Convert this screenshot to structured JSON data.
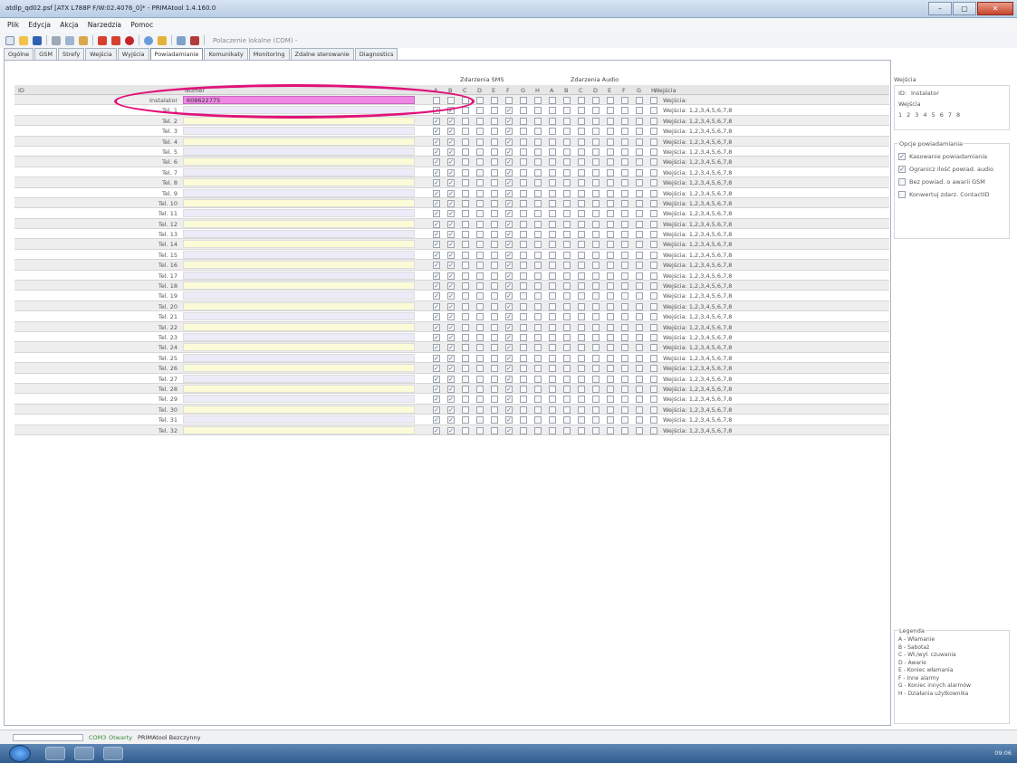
{
  "window": {
    "title": "atdlp_qd02.psf [ATX L788P F/W:02.4076_0]* - PRIMAtool 1.4.160.0",
    "buttons": [
      "–",
      "▢",
      "✕"
    ]
  },
  "menu": [
    "Plik",
    "Edycja",
    "Akcja",
    "Narzedzia",
    "Pomoc"
  ],
  "toolbar": {
    "connection_label": "Polaczenie lokalne (COM) -"
  },
  "tabs": [
    "Ogólne",
    "GSM",
    "Strefy",
    "Wejścia",
    "Wyjścia",
    "Powiadamianie",
    "Komunikaty",
    "Monitoring",
    "Zdalne sterowanie",
    "Diagnostics"
  ],
  "active_tab": "Powiadamianie",
  "group_headers": {
    "sms": "Zdarzenia SMS",
    "audio": "Zdarzenia Audio"
  },
  "columns": {
    "id": "ID",
    "name": "Numer",
    "sms_letters": [
      "A",
      "B",
      "C",
      "D",
      "E",
      "F",
      "G",
      "H"
    ],
    "audio_letters": [
      "A",
      "B",
      "C",
      "D",
      "E",
      "F",
      "G",
      "H"
    ],
    "inputs": "Wejścia"
  },
  "rows": [
    {
      "id": "Instalator",
      "number": "608622775",
      "inputs": "Wejścia:"
    },
    {
      "id": "Tel. 1",
      "number": "",
      "inputs": "Wejścia: 1,2,3,4,5,6,7,8"
    },
    {
      "id": "Tel. 2",
      "number": "",
      "inputs": "Wejścia: 1,2,3,4,5,6,7,8"
    },
    {
      "id": "Tel. 3",
      "number": "",
      "inputs": "Wejścia: 1,2,3,4,5,6,7,8"
    },
    {
      "id": "Tel. 4",
      "number": "",
      "inputs": "Wejścia: 1,2,3,4,5,6,7,8"
    },
    {
      "id": "Tel. 5",
      "number": "",
      "inputs": "Wejścia: 1,2,3,4,5,6,7,8"
    },
    {
      "id": "Tel. 6",
      "number": "",
      "inputs": "Wejścia: 1,2,3,4,5,6,7,8"
    },
    {
      "id": "Tel. 7",
      "number": "",
      "inputs": "Wejścia: 1,2,3,4,5,6,7,8"
    },
    {
      "id": "Tel. 8",
      "number": "",
      "inputs": "Wejścia: 1,2,3,4,5,6,7,8"
    },
    {
      "id": "Tel. 9",
      "number": "",
      "inputs": "Wejścia: 1,2,3,4,5,6,7,8"
    },
    {
      "id": "Tel. 10",
      "number": "",
      "inputs": "Wejścia: 1,2,3,4,5,6,7,8"
    },
    {
      "id": "Tel. 11",
      "number": "",
      "inputs": "Wejścia: 1,2,3,4,5,6,7,8"
    },
    {
      "id": "Tel. 12",
      "number": "",
      "inputs": "Wejścia: 1,2,3,4,5,6,7,8"
    },
    {
      "id": "Tel. 13",
      "number": "",
      "inputs": "Wejścia: 1,2,3,4,5,6,7,8"
    },
    {
      "id": "Tel. 14",
      "number": "",
      "inputs": "Wejścia: 1,2,3,4,5,6,7,8"
    },
    {
      "id": "Tel. 15",
      "number": "",
      "inputs": "Wejścia: 1,2,3,4,5,6,7,8"
    },
    {
      "id": "Tel. 16",
      "number": "",
      "inputs": "Wejścia: 1,2,3,4,5,6,7,8"
    },
    {
      "id": "Tel. 17",
      "number": "",
      "inputs": "Wejścia: 1,2,3,4,5,6,7,8"
    },
    {
      "id": "Tel. 18",
      "number": "",
      "inputs": "Wejścia: 1,2,3,4,5,6,7,8"
    },
    {
      "id": "Tel. 19",
      "number": "",
      "inputs": "Wejścia: 1,2,3,4,5,6,7,8"
    },
    {
      "id": "Tel. 20",
      "number": "",
      "inputs": "Wejścia: 1,2,3,4,5,6,7,8"
    },
    {
      "id": "Tel. 21",
      "number": "",
      "inputs": "Wejścia: 1,2,3,4,5,6,7,8"
    },
    {
      "id": "Tel. 22",
      "number": "",
      "inputs": "Wejścia: 1,2,3,4,5,6,7,8"
    },
    {
      "id": "Tel. 23",
      "number": "",
      "inputs": "Wejścia: 1,2,3,4,5,6,7,8"
    },
    {
      "id": "Tel. 24",
      "number": "",
      "inputs": "Wejścia: 1,2,3,4,5,6,7,8"
    },
    {
      "id": "Tel. 25",
      "number": "",
      "inputs": "Wejścia: 1,2,3,4,5,6,7,8"
    },
    {
      "id": "Tel. 26",
      "number": "",
      "inputs": "Wejścia: 1,2,3,4,5,6,7,8"
    },
    {
      "id": "Tel. 27",
      "number": "",
      "inputs": "Wejścia: 1,2,3,4,5,6,7,8"
    },
    {
      "id": "Tel. 28",
      "number": "",
      "inputs": "Wejścia: 1,2,3,4,5,6,7,8"
    },
    {
      "id": "Tel. 29",
      "number": "",
      "inputs": "Wejścia: 1,2,3,4,5,6,7,8"
    },
    {
      "id": "Tel. 30",
      "number": "",
      "inputs": "Wejścia: 1,2,3,4,5,6,7,8"
    },
    {
      "id": "Tel. 31",
      "number": "",
      "inputs": "Wejścia: 1,2,3,4,5,6,7,8"
    },
    {
      "id": "Tel. 32",
      "number": "",
      "inputs": "Wejścia: 1,2,3,4,5,6,7,8"
    }
  ],
  "checked_sms": [
    "A",
    "B",
    "F"
  ],
  "checkmark": "✓",
  "right_panel": {
    "inputs_group": {
      "title": "Wejścia",
      "id_label": "ID:",
      "id_value": "Instalator",
      "inputs_label": "Wejścia",
      "inputs_values": [
        "1",
        "2",
        "3",
        "4",
        "5",
        "6",
        "7",
        "8"
      ]
    },
    "options_group": {
      "title": "Opcje powiadamiania",
      "options": [
        {
          "label": "Kasowanie powiadamiania",
          "checked": true
        },
        {
          "label": "Ogranicz ilość powiad. audio",
          "checked": true
        },
        {
          "label": "Bez powiad. o awarii GSM",
          "checked": false
        },
        {
          "label": "Konwertuj zdarz. ContactID",
          "checked": false
        }
      ]
    },
    "legend": {
      "title": "Legenda",
      "items": [
        "A - Włamanie",
        "B - Sabotaż",
        "C - Wł./wył. czuwania",
        "D - Awarie",
        "E - Koniec włamania",
        "F - Inne alarmy",
        "G - Koniec innych alarmów",
        "H - Działania użytkownika"
      ]
    }
  },
  "status": {
    "port": "COM3",
    "state": "Otwarty",
    "app": "PRIMAtool Bezczynny"
  },
  "taskbar": {
    "tray_time": "09:06"
  },
  "colors": {
    "highlight_oval": "#e0127a",
    "installer_fill": "#ee88e2",
    "name_cell": "#fbfbd8"
  }
}
